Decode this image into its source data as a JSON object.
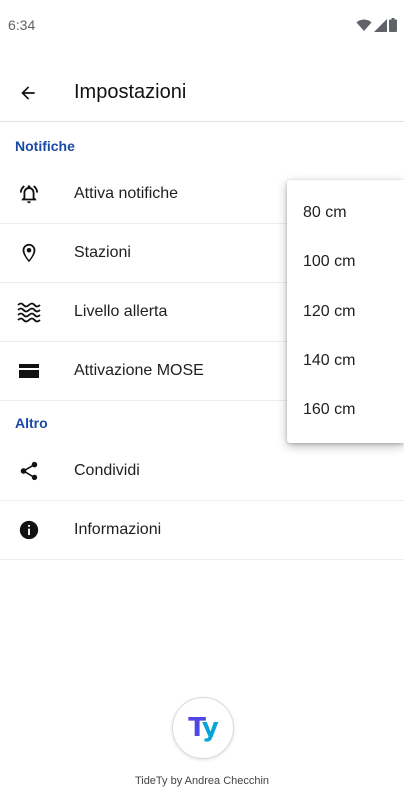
{
  "status_bar": {
    "time": "6:34",
    "icons": [
      "wifi-icon",
      "cellular-signal-icon",
      "battery-icon"
    ]
  },
  "app_bar": {
    "title": "Impostazioni",
    "back_icon": "arrow-back-icon"
  },
  "sections": {
    "notifiche": {
      "title": "Notifiche",
      "items": [
        {
          "label": "Attiva notifiche",
          "icon": "alarm-bell-icon"
        },
        {
          "label": "Stazioni",
          "icon": "location-pin-icon"
        },
        {
          "label": "Livello allerta",
          "icon": "waves-icon"
        },
        {
          "label": "Attivazione MOSE",
          "icon": "barrier-icon"
        }
      ]
    },
    "altro": {
      "title": "Altro",
      "items": [
        {
          "label": "Condividi",
          "icon": "share-icon"
        },
        {
          "label": "Informazioni",
          "icon": "info-icon"
        }
      ]
    }
  },
  "dropdown": {
    "options": [
      "80 cm",
      "100 cm",
      "120 cm",
      "140 cm",
      "160 cm"
    ]
  },
  "footer": {
    "logo_t": "T",
    "logo_y": "y",
    "credit": "TideTy by Andrea Checchin"
  },
  "colors": {
    "accent": "#1a4aa6",
    "logo_t": "#4f46e5",
    "logo_y": "#06a4d9"
  }
}
